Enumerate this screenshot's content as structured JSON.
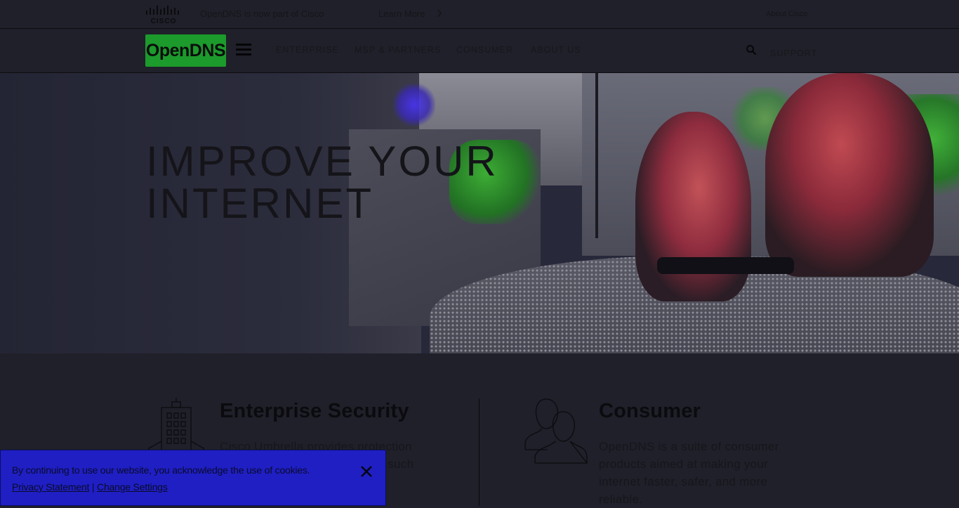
{
  "topbar": {
    "message": "OpenDNS is now part of Cisco",
    "learn_more": "Learn More",
    "about": "About Cisco"
  },
  "nav": {
    "logo_text": "OpenDNS",
    "items": [
      "ENTERPRISE",
      "MSP & PARTNERS",
      "CONSUMER",
      "ABOUT US"
    ],
    "support": "SUPPORT"
  },
  "hero": {
    "title_line1": "IMPROVE YOUR",
    "title_line2": "INTERNET"
  },
  "features": {
    "enterprise": {
      "title": "Enterprise Security",
      "body": "Cisco Umbrella provides protection against threats on the internet such"
    },
    "consumer": {
      "title": "Consumer",
      "body": "OpenDNS is a suite of consumer products aimed at making your internet faster, safer, and more reliable."
    }
  },
  "cookie": {
    "text": "By continuing to use our website, you acknowledge the use of cookies.",
    "privacy_link": "Privacy Statement",
    "separator": " | ",
    "settings_link": "Change Settings"
  },
  "icons": {
    "cisco_logo": "cisco-logo",
    "chevron": "chevron-right-icon",
    "menu": "hamburger-icon",
    "search": "search-icon",
    "building": "building-icon",
    "people": "people-icon",
    "close": "close-icon"
  },
  "colors": {
    "brand_green": "#1c9a2c",
    "cookie_banner": "#1f1fc4",
    "page_background": "#1f2029"
  }
}
